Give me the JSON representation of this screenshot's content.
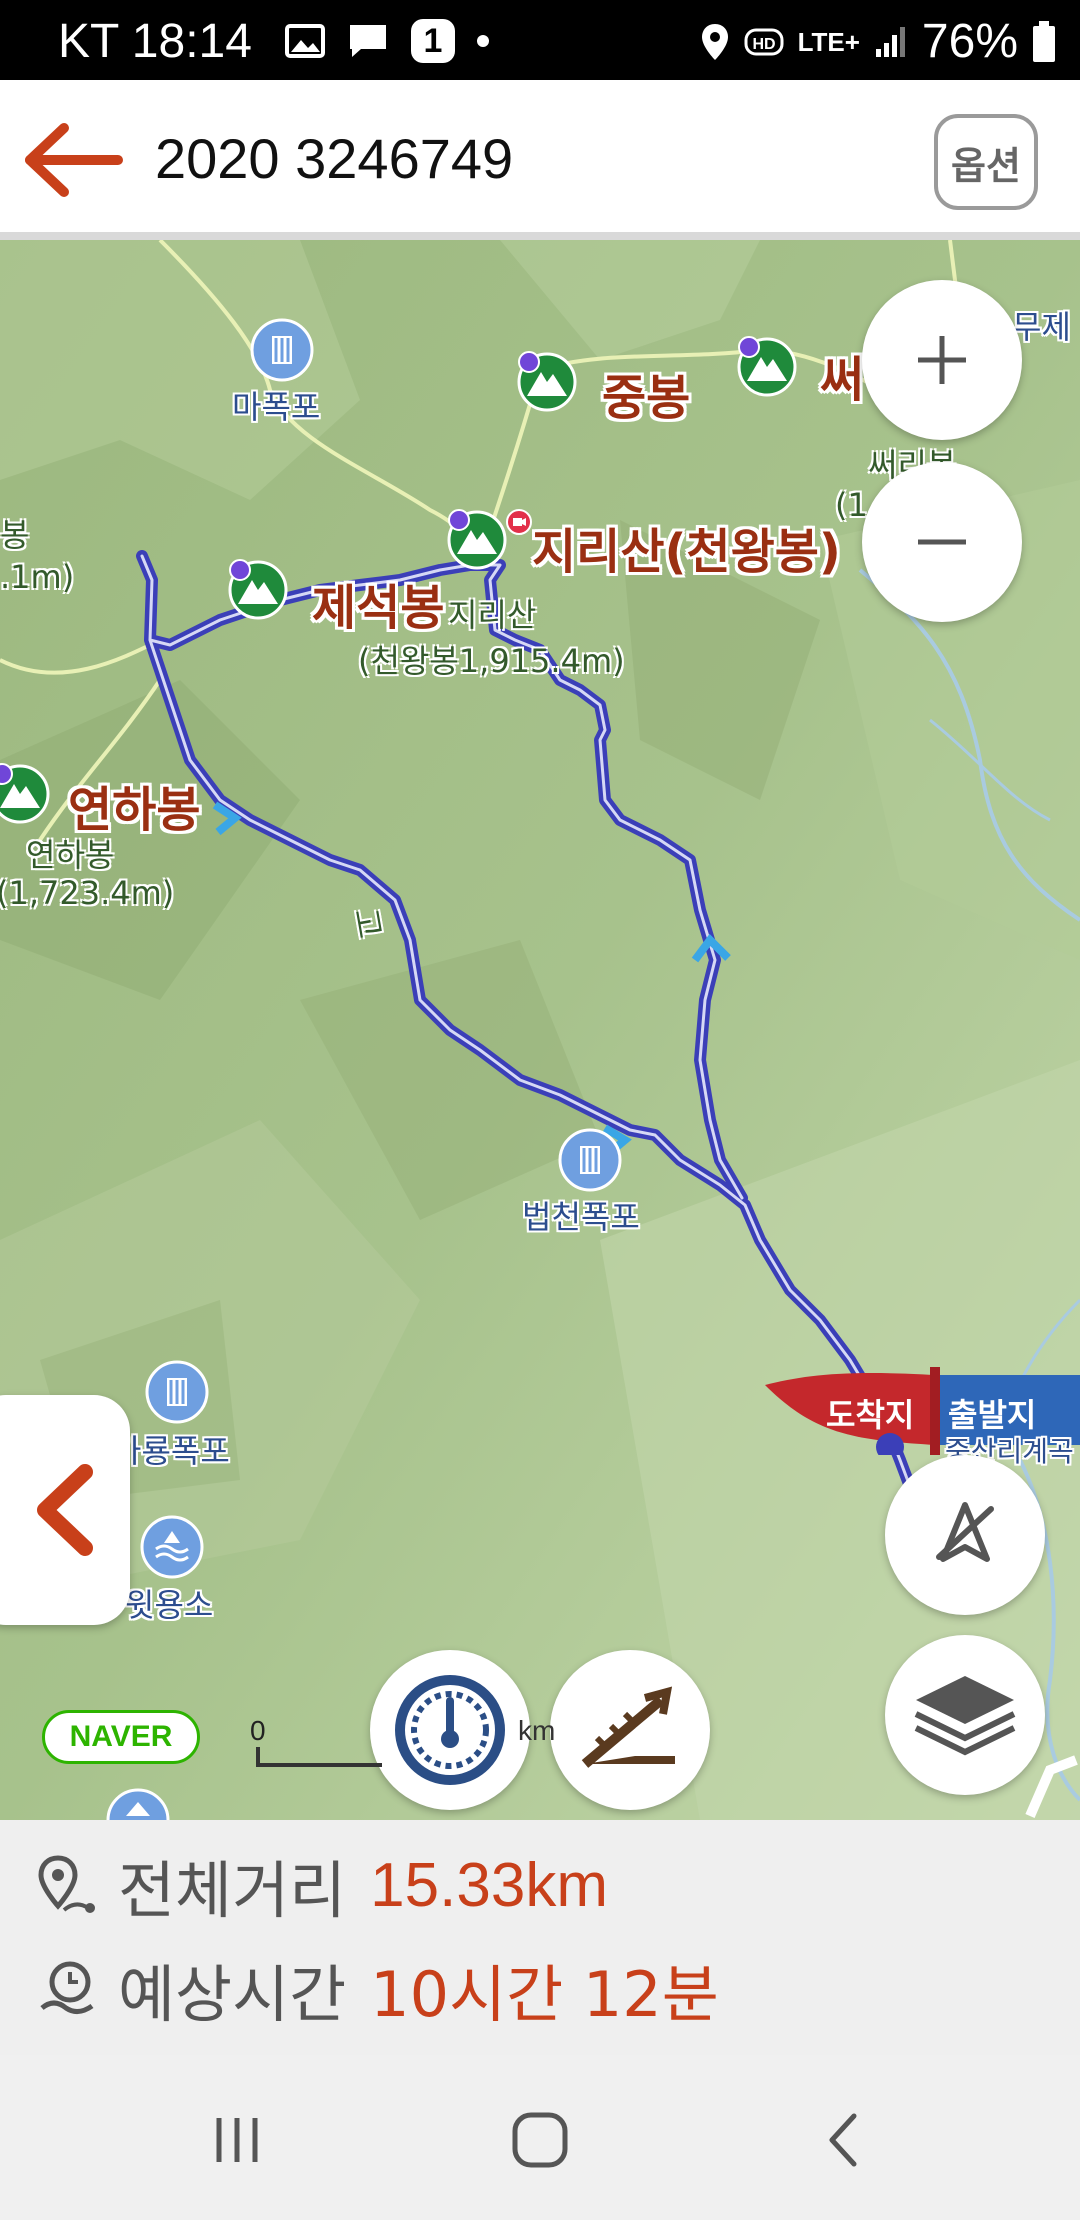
{
  "status_bar": {
    "carrier_time": "KT 18:14",
    "notification_count": "1",
    "network": "LTE+",
    "battery": "76%"
  },
  "header": {
    "title": "2020 3246749",
    "option_label": "옵션"
  },
  "map": {
    "labels": {
      "mapokpo": "마폭포",
      "jungbong": "중봉",
      "sseo": "써",
      "sseoribong": "써리봉",
      "sseoribong_paren": "(1",
      "jirisan_big": "지리산(천왕봉)",
      "jirisan_small": "지리산",
      "cheonwang_height": "(천왕봉1,915.4m)",
      "jeseokbong": "제석봉",
      "yeonhabong_big": "연하봉",
      "yeonhabong_small": "연하봉",
      "yeonhabong_height": "(1,723.4m)",
      "bong_left": "봉",
      "height_left": ".1m)",
      "beopcheon": "법천폭포",
      "garyong": "가룡폭포",
      "witnyongso": "윗용소",
      "muje": "무제",
      "arrival": "도착지",
      "departure": "출발지",
      "jungsanri": "중산리계곡",
      "trail_sub": "고"
    },
    "naver_badge": "NAVER",
    "scale_zero": "0",
    "scale_unit": "km"
  },
  "info": {
    "distance_label": "전체거리",
    "distance_value": "15.33km",
    "time_label": "예상시간",
    "time_value": "10시간 12분"
  },
  "colors": {
    "accent": "#c8401a",
    "route": "#3b3fb8",
    "peak_text": "#9a2f12",
    "poi_text": "#2c4d8e"
  }
}
